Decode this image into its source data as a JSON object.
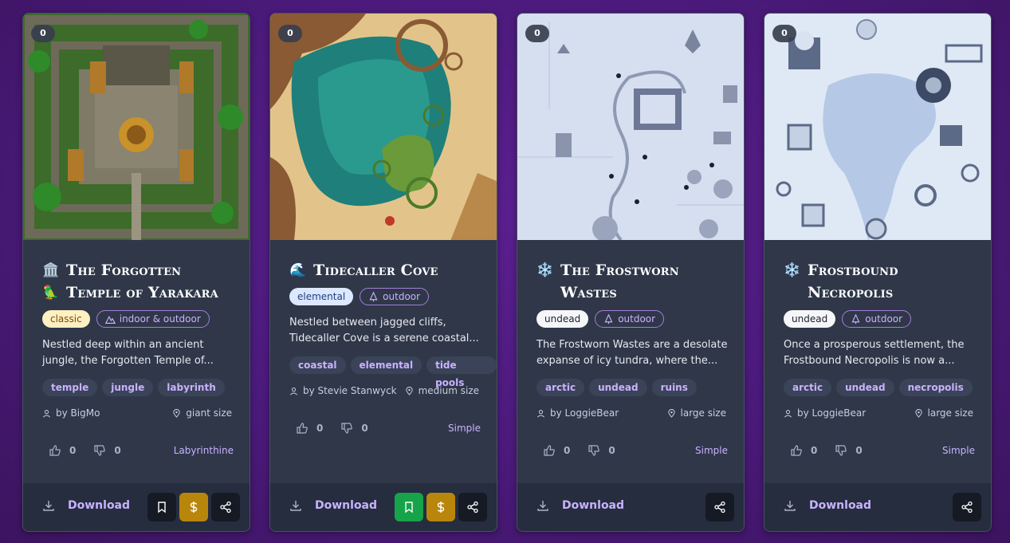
{
  "accent": "#c9b2ff",
  "cards": [
    {
      "count": "0",
      "title": "The Forgotten Temple of Yarakara",
      "title_icons": [
        "🏛️",
        "🦜"
      ],
      "type_badge": "classic",
      "env_badge": "indoor & outdoor",
      "description": "Nestled deep within an ancient jungle, the Forgotten Temple of...",
      "tags": [
        "temple",
        "jungle",
        "labyrinth"
      ],
      "author": "by BigMo",
      "size": "giant size",
      "likes": "0",
      "dislikes": "0",
      "level": "Labyrinthine",
      "download": "Download"
    },
    {
      "count": "0",
      "title": "Tidecaller Cove",
      "title_icons": [
        "🌊"
      ],
      "type_badge": "elemental",
      "env_badge": "outdoor",
      "description": "Nestled between jagged cliffs, Tidecaller Cove is a serene coastal...",
      "tags": [
        "coastal",
        "elemental",
        "tide pools"
      ],
      "author": "by Stevie Stanwyck",
      "size": "medium size",
      "likes": "0",
      "dislikes": "0",
      "level": "Simple",
      "download": "Download"
    },
    {
      "count": "0",
      "title": "The Frostworn Wastes",
      "title_icons": [
        "❄️"
      ],
      "type_badge": "undead",
      "env_badge": "outdoor",
      "description": "The Frostworn Wastes are a desolate expanse of icy tundra, where the...",
      "tags": [
        "arctic",
        "undead",
        "ruins"
      ],
      "author": "by LoggieBear",
      "size": "large size",
      "likes": "0",
      "dislikes": "0",
      "level": "Simple",
      "download": "Download"
    },
    {
      "count": "0",
      "title": "Frostbound Necropolis",
      "title_icons": [
        "❄️"
      ],
      "type_badge": "undead",
      "env_badge": "outdoor",
      "description": "Once a prosperous settlement, the Frostbound Necropolis is now a...",
      "tags": [
        "arctic",
        "undead",
        "necropolis"
      ],
      "author": "by LoggieBear",
      "size": "large size",
      "likes": "0",
      "dislikes": "0",
      "level": "Simple",
      "download": "Download"
    }
  ]
}
